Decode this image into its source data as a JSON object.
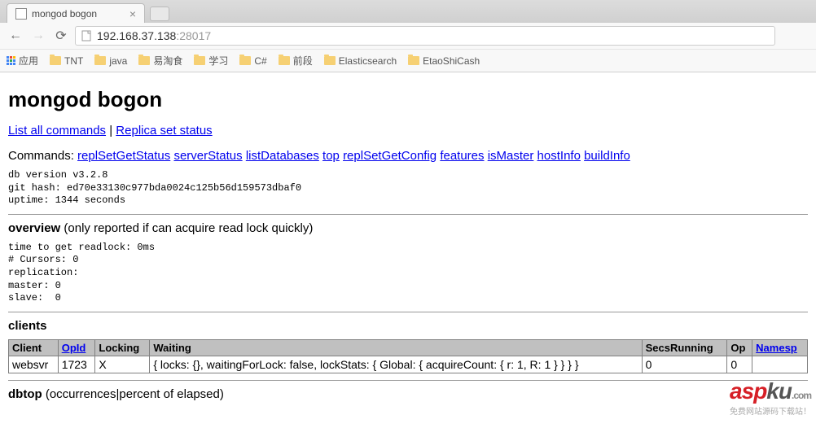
{
  "browser": {
    "tab_title": "mongod bogon",
    "url_host": "192.168.37.138",
    "url_port": ":28017"
  },
  "bookmarks": {
    "apps_label": "应用",
    "items": [
      "TNT",
      "java",
      "易淘食",
      "学习",
      "C#",
      "前段",
      "Elasticsearch",
      "EtaoShiCash"
    ]
  },
  "page": {
    "title": "mongod bogon",
    "links": {
      "list_all": "List all commands",
      "replica_status": "Replica set status"
    },
    "commands_label": "Commands:",
    "commands": [
      "replSetGetStatus",
      "serverStatus",
      "listDatabases",
      "top",
      "replSetGetConfig",
      "features",
      "isMaster",
      "hostInfo",
      "buildInfo"
    ],
    "version_block": "db version v3.2.8\ngit hash: ed70e33130c977bda0024c125b56d159573dbaf0\nuptime: 1344 seconds",
    "overview_title": "overview",
    "overview_note": "(only reported if can acquire read lock quickly)",
    "overview_block": "time to get readlock: 0ms\n# Cursors: 0\nreplication:\nmaster: 0\nslave:  0",
    "clients_title": "clients",
    "clients_table": {
      "headers": [
        "Client",
        "OpId",
        "Locking",
        "Waiting",
        "SecsRunning",
        "Op",
        "Namesp"
      ],
      "link_headers": [
        1,
        6
      ],
      "row": {
        "client": "websvr",
        "opid": "1723",
        "locking": "X",
        "waiting": "{ locks: {}, waitingForLock: false, lockStats: { Global: { acquireCount: { r: 1, R: 1 } } } }",
        "secs": "0",
        "op": "0",
        "ns": ""
      }
    },
    "dbtop_title": "dbtop",
    "dbtop_note": "(occurrences|percent of elapsed)"
  },
  "watermark": {
    "logo_text": "aspku",
    "dotcom": ".com",
    "subtitle": "免费网站源码下载站！"
  }
}
